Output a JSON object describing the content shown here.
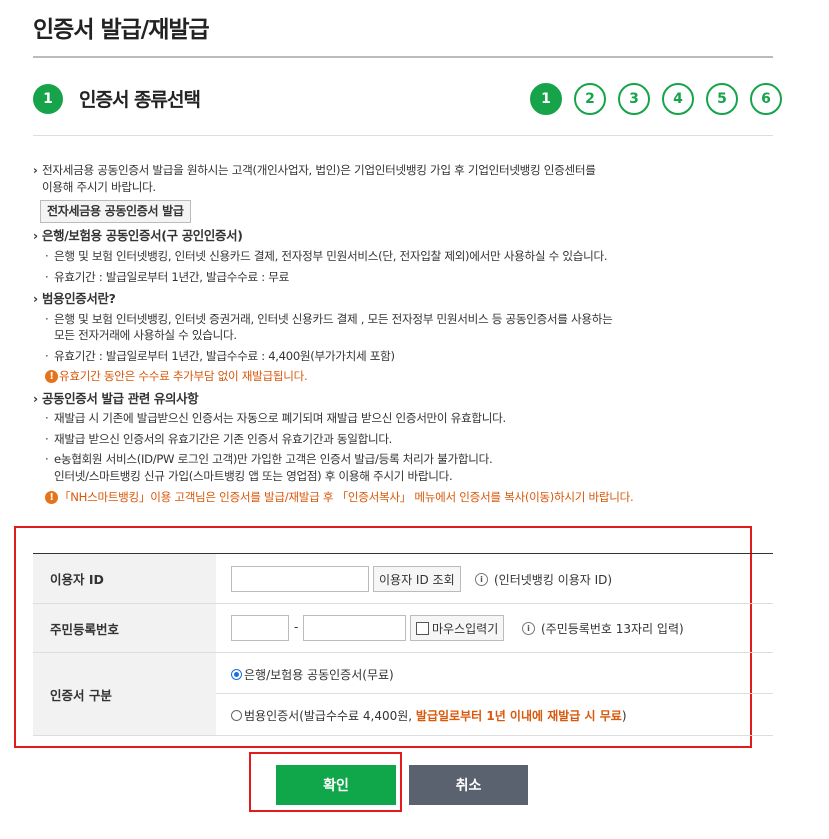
{
  "page_title": "인증서 발급/재발급",
  "section": {
    "number": "1",
    "title": "인증서 종류선택"
  },
  "steps": [
    "1",
    "2",
    "3",
    "4",
    "5",
    "6"
  ],
  "info": {
    "tax_line1": "전자세금용 공동인증서 발급을 원하시는 고객(개인사업자, 법인)은 기업인터넷뱅킹 가입 후 기업인터넷뱅킹 인증센터를",
    "tax_line2": "이용해 주시기 바랍니다.",
    "tax_button": "전자세금용 공동인증서 발급",
    "bank_head": "은행/보험용 공동인증서(구 공인인증서)",
    "bank_use": "은행 및 보험 인터넷뱅킹, 인터넷 신용카드 결제, 전자정부 민원서비스(단, 전자입찰 제외)에서만 사용하실 수 있습니다.",
    "bank_validity": "유효기간 : 발급일로부터 1년간, 발급수수료 : 무료",
    "general_head": "범용인증서란?",
    "general_use1": "은행 및 보험 인터넷뱅킹, 인터넷 증권거래, 인터넷 신용카드 결제 , 모든 전자정부 민원서비스 등 공동인증서를 사용하는",
    "general_use2": "모든 전자거래에 사용하실 수 있습니다.",
    "general_validity": "유효기간 : 발급일로부터 1년간, 발급수수료 : 4,400원(부가가치세 포함)",
    "general_warn": "유효기간 동안은 수수료 추가부담 없이 재발급됩니다.",
    "notice_head": "공동인증서 발급 관련 유의사항",
    "notice1": "재발급 시 기존에 발급받으신 인증서는 자동으로 폐기되며 재발급 받으신 인증서만이 유효합니다.",
    "notice2": "재발급 받으신 인증서의 유효기간은 기존 인증서 유효기간과 동일합니다.",
    "notice3_line1": "e농협회원 서비스(ID/PW 로그인 고객)만 가입한 고객은 인증서 발급/등록 처리가 불가합니다.",
    "notice3_line2": "인터넷/스마트뱅킹 신규 가입(스마트뱅킹 앱 또는 영업점) 후 이용해 주시기 바랍니다.",
    "notice_warn": "「NH스마트뱅킹」이용 고객님은 인증서를 발급/재발급 후 「인증서복사」 메뉴에서 인증서를 복사(이동)하시기 바랍니다."
  },
  "form": {
    "user_id_label": "이용자 ID",
    "user_id_value": "",
    "user_id_button": "이용자 ID 조회",
    "user_id_hint": "(인터넷뱅킹 이용자 ID)",
    "rrn_label": "주민등록번호",
    "rrn_front": "",
    "rrn_dash": "-",
    "rrn_back": "",
    "mouse_input_label": "마우스입력기",
    "rrn_hint": "(주민등록번호 13자리 입력)",
    "cert_type_label": "인증서 구분",
    "option_bank": "은행/보험용 공동인증서(무료)",
    "option_general_prefix": "범용인증서(발급수수료 4,400원, ",
    "option_general_strong": "발급일로부터 1년 이내에 재발급 시 무료",
    "option_general_suffix": ")",
    "selected": "bank"
  },
  "buttons": {
    "confirm": "확인",
    "cancel": "취소"
  },
  "colors": {
    "accent_green": "#16a34a",
    "highlight_red": "#e31b1b",
    "warning_orange": "#d9580b",
    "cancel_gray": "#5a6270"
  }
}
